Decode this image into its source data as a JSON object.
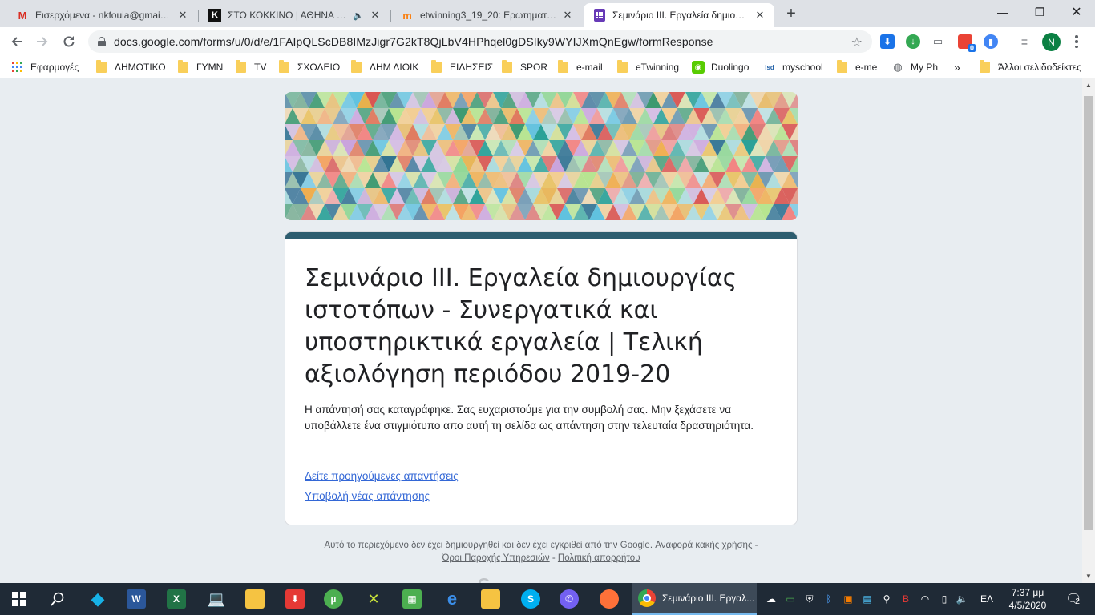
{
  "tabs": [
    {
      "title": "Εισερχόμενα - nkfouia@gmail.co",
      "icon": "gmail-icon"
    },
    {
      "title": "ΣΤΟ ΚΟΚΚΙΝΟ | ΑΘΗΝΑ 105",
      "icon": "stokokkino-icon"
    },
    {
      "title": "etwinning3_19_20: Ερωτηματολό",
      "icon": "moodle-icon"
    },
    {
      "title": "Σεμινάριο ΙΙΙ. Εργαλεία δημιουργ",
      "icon": "google-forms-icon"
    }
  ],
  "address_bar": {
    "url": "docs.google.com/forms/u/0/d/e/1FAIpQLScDB8IMzJigr7G2kT8QjLbV4HPhqel0gDSIky9WYIJXmQnEgw/formResponse"
  },
  "extensions": {
    "badge_count": "0"
  },
  "profile": {
    "initial": "N"
  },
  "bookmarks": [
    {
      "label": "Εφαρμογές",
      "type": "apps"
    },
    {
      "label": "ΔΗΜΟΤΙΚΟ",
      "type": "folder"
    },
    {
      "label": "ΓΥΜΝ",
      "type": "folder"
    },
    {
      "label": "TV",
      "type": "folder"
    },
    {
      "label": "ΣΧΟΛΕΙΟ",
      "type": "folder"
    },
    {
      "label": "ΔΗΜ ΔΙΟΙΚ",
      "type": "folder"
    },
    {
      "label": "ΕΙΔΗΣΕΙΣ",
      "type": "folder"
    },
    {
      "label": "SPOR",
      "type": "folder"
    },
    {
      "label": "e-mail",
      "type": "folder"
    },
    {
      "label": "eTwinning",
      "type": "folder"
    },
    {
      "label": "Duolingo",
      "type": "site"
    },
    {
      "label": "myschool",
      "type": "site"
    },
    {
      "label": "e-me",
      "type": "folder"
    },
    {
      "label": "My Ph",
      "type": "site"
    },
    {
      "label": "»",
      "type": "overflow"
    },
    {
      "label": "Άλλοι σελιδοδείκτες",
      "type": "folder"
    }
  ],
  "form": {
    "title": "Σεμινάριο ΙΙΙ. Εργαλεία δημιουργίας ιστοτόπων - Συνεργατικά και υποστηρικτικά εργαλεία | Τελική αξιολόγηση περιόδου 2019-20",
    "confirmation_message": "Η απάντησή σας καταγράφηκε. Σας ευχαριστούμε για την συμβολή σας. Μην ξεχάσετε να υποβάλλετε ένα στιγμιότυπο απο αυτή τη σελίδα ως απάντηση στην τελευταία δραστηριότητα.",
    "view_previous_link": "Δείτε προηγούμενες απαντήσεις",
    "submit_another_link": "Υποβολή νέας απάντησης",
    "theme_color": "#2d5d6f"
  },
  "footer": {
    "disclaimer": "Αυτό το περιεχόμενο δεν έχει δημιουργηθεί και δεν έχει εγκριθεί από την Google.",
    "report_abuse": "Αναφορά κακής χρήσης",
    "sep1": " - ",
    "terms": "Όροι Παροχής Υπηρεσιών",
    "sep2": " - ",
    "privacy": "Πολιτική απορρήτου"
  },
  "taskbar": {
    "active_window": "Σεμινάριο ΙΙΙ. Εργαλ...",
    "language": "ΕΛ",
    "time": "7:37 μμ",
    "date": "4/5/2020",
    "notification_count": "2"
  }
}
